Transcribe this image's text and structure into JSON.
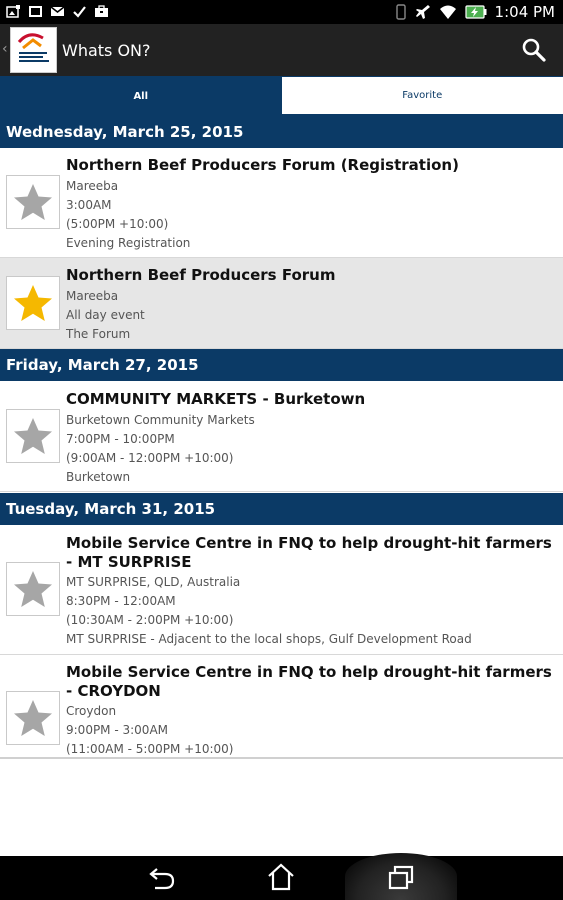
{
  "status_bar": {
    "time": "1:04 PM",
    "icons": [
      "photo-icon",
      "screenshot-icon",
      "gmail-icon",
      "check-icon",
      "briefcase-icon",
      "vibrate-icon",
      "airplane-icon",
      "wifi-icon",
      "battery-charging-icon"
    ]
  },
  "action_bar": {
    "title": "Whats ON?",
    "logo": "app-logo",
    "search_icon": "search-icon"
  },
  "tabs": [
    {
      "label": "All",
      "selected": true
    },
    {
      "label": "Favorite",
      "selected": false
    }
  ],
  "sections": [
    {
      "date": "Wednesday, March 25, 2015",
      "events": [
        {
          "title": "Northern Beef Producers Forum (Registration)",
          "lines": [
            "Mareeba",
            "3:00AM",
            "(5:00PM +10:00)",
            "Evening Registration"
          ],
          "favorite": false
        },
        {
          "title": "Northern Beef Producers Forum",
          "lines": [
            "Mareeba",
            "All day event",
            "The Forum"
          ],
          "favorite": true
        }
      ]
    },
    {
      "date": "Friday, March 27, 2015",
      "events": [
        {
          "title": "COMMUNITY MARKETS - Burketown",
          "lines": [
            "Burketown Community Markets",
            "7:00PM - 10:00PM",
            "(9:00AM - 12:00PM +10:00)",
            "Burketown"
          ],
          "favorite": false
        }
      ]
    },
    {
      "date": "Tuesday, March 31, 2015",
      "events": [
        {
          "title": "Mobile Service Centre in FNQ to help drought-hit farmers - MT SURPRISE",
          "lines": [
            "MT SURPRISE, QLD, Australia",
            "8:30PM - 12:00AM",
            "(10:30AM - 2:00PM +10:00)",
            "MT SURPRISE - Adjacent to the local shops, Gulf Development Road"
          ],
          "favorite": false
        },
        {
          "title": "Mobile Service Centre in FNQ to help drought-hit farmers - CROYDON",
          "lines": [
            "Croydon",
            "9:00PM - 3:00AM",
            "(11:00AM - 5:00PM +10:00)"
          ],
          "favorite": false
        }
      ]
    }
  ],
  "colors": {
    "header_blue": "#0b3a66",
    "star_gold": "#f5b800",
    "star_gray": "#a6a6a6",
    "fav_row": "#e6e6e6"
  },
  "nav_bar": {
    "icons": [
      "back-icon",
      "home-icon",
      "recent-apps-icon"
    ]
  }
}
